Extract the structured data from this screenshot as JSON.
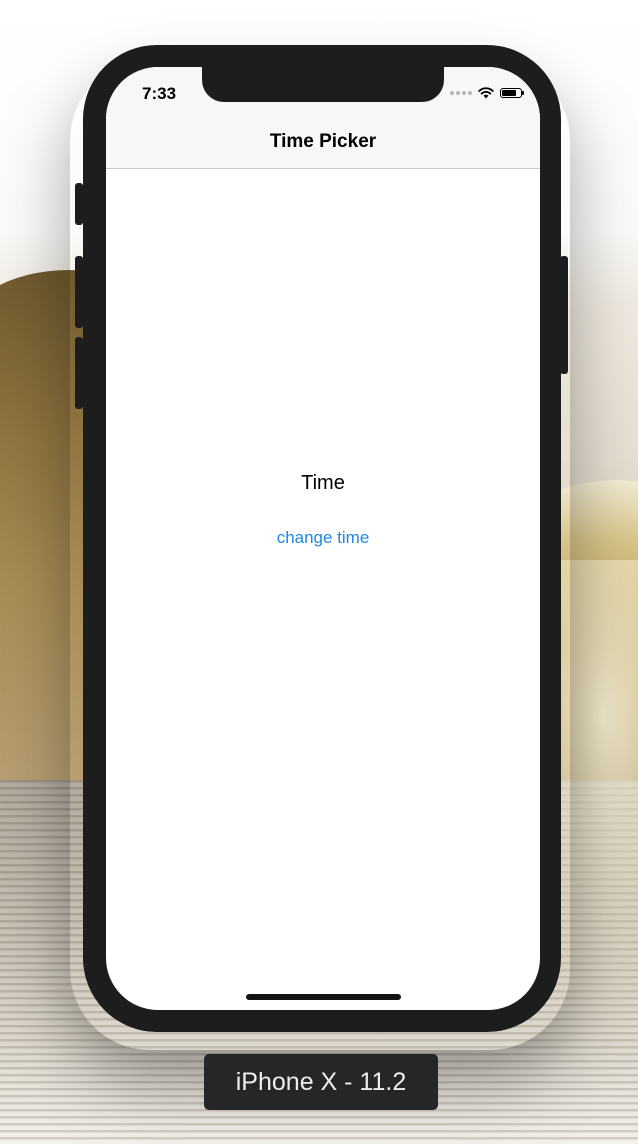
{
  "status_bar": {
    "time": "7:33",
    "icons": [
      "signal-dots-icon",
      "wifi-icon",
      "battery-icon"
    ],
    "battery_level_fraction": 0.75
  },
  "navigation": {
    "title": "Time Picker"
  },
  "main": {
    "time_label": "Time",
    "change_time_link": "change time"
  },
  "simulator": {
    "device_label": "iPhone X - 11.2"
  },
  "colors": {
    "link": "#1e88e5",
    "nav_background": "#f7f7f7",
    "screen_background": "#ffffff",
    "device_frame": "#1d1d1d"
  }
}
